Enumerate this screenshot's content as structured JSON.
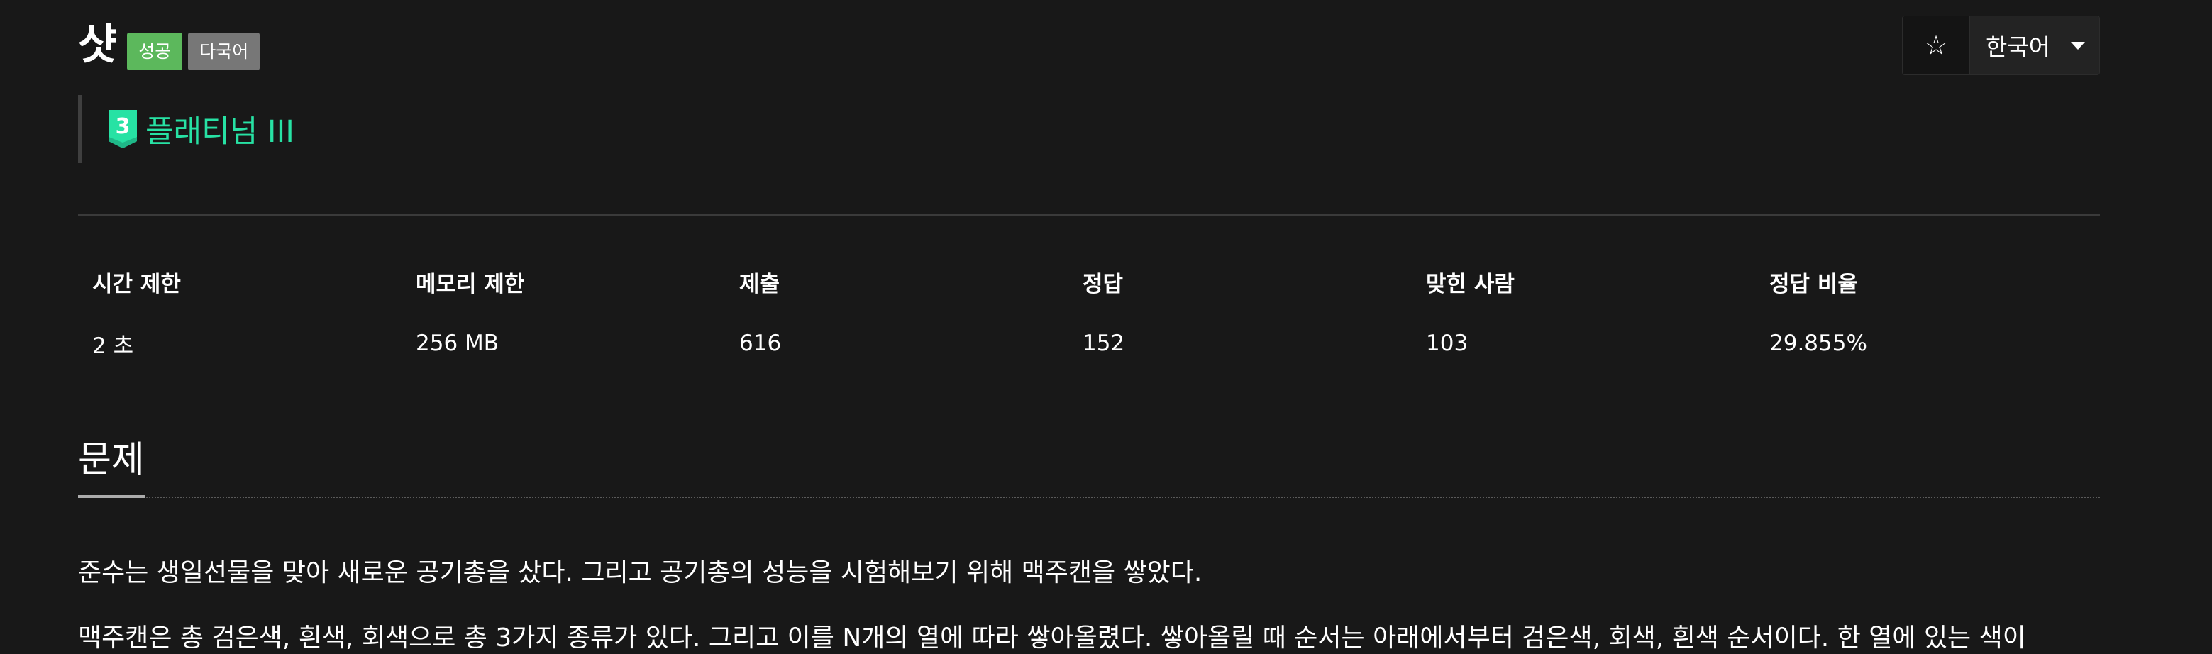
{
  "problem": {
    "title": "샷",
    "labels": {
      "success": "성공",
      "multilang": "다국어"
    },
    "tier": {
      "number": "3",
      "name": "플래티넘 III",
      "color": "#27e2a4"
    }
  },
  "controls": {
    "star_icon": "☆",
    "language": "한국어"
  },
  "info_table": {
    "headers": [
      "시간 제한",
      "메모리 제한",
      "제출",
      "정답",
      "맞힌 사람",
      "정답 비율"
    ],
    "values": [
      "2 초",
      "256 MB",
      "616",
      "152",
      "103",
      "29.855%"
    ]
  },
  "section": {
    "heading": "문제",
    "paragraphs": [
      "준수는 생일선물을 맞아 새로운 공기총을 샀다. 그리고 공기총의 성능을 시험해보기 위해 맥주캔을 쌓았다.",
      "맥주캔은 총 검은색, 흰색, 회색으로 총 3가지 종류가 있다. 그리고 이를 N개의 열에 따라 쌓아올렸다. 쌓아올릴 때 순서는 아래에서부터 검은색, 회색, 흰색 순서이다. 한 열에 있는 색이"
    ]
  },
  "colors": {
    "success": "#5cb85c",
    "lang_label": "#777777",
    "background": "#181818"
  }
}
